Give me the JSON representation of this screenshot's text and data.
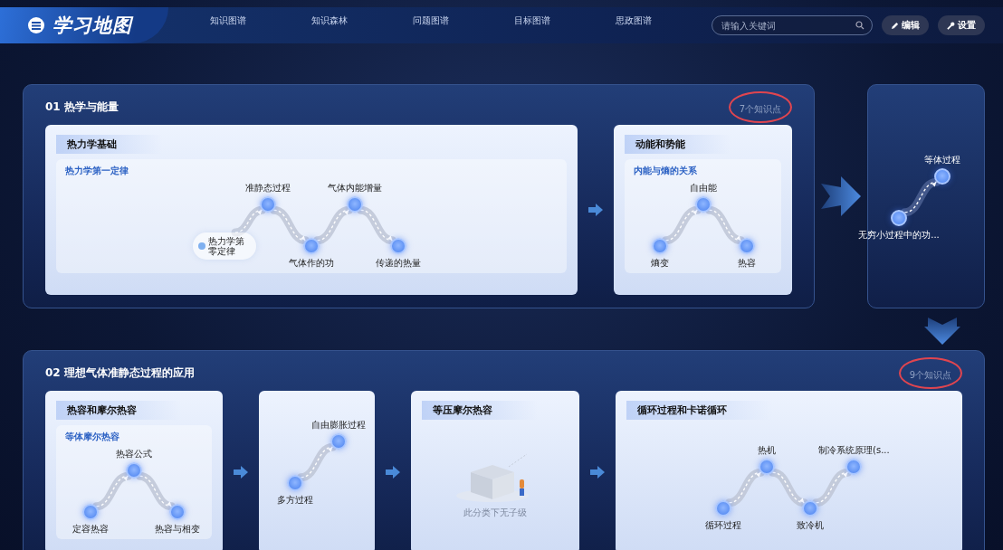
{
  "header": {
    "logo": "学习地图",
    "nav": [
      {
        "label": "知识图谱",
        "selected": false
      },
      {
        "label": "知识森林",
        "selected": false
      },
      {
        "label": "问题图谱",
        "selected": false
      },
      {
        "label": "目标图谱",
        "selected": false
      },
      {
        "label": "思政图谱",
        "selected": false
      }
    ],
    "search": {
      "placeholder": "请输入关键词"
    },
    "buttons": [
      {
        "kind": "edit",
        "label": "编辑"
      },
      {
        "kind": "settings",
        "label": "设置"
      }
    ]
  },
  "sections": [
    {
      "number": "01",
      "title": "热学与能量",
      "count": "7个知识点",
      "count_circled": true,
      "cards": [
        {
          "title": "热力学基础",
          "groups": [
            {
              "title": "热力学第一定律",
              "nodes": [
                {
                  "label": "热力学第零定律",
                  "kind": "start"
                },
                {
                  "label": "准静态过程",
                  "kind": "node"
                },
                {
                  "label": "气体作的功",
                  "kind": "node"
                },
                {
                  "label": "气体内能增量",
                  "kind": "node"
                },
                {
                  "label": "传递的热量",
                  "kind": "node"
                }
              ]
            }
          ]
        },
        {
          "title": "动能和势能",
          "groups": [
            {
              "title": "内能与熵的关系",
              "nodes": [
                {
                  "label": "熵变",
                  "kind": "node"
                },
                {
                  "label": "自由能",
                  "kind": "node"
                },
                {
                  "label": "热容",
                  "kind": "node"
                }
              ]
            }
          ]
        }
      ]
    },
    {
      "number": "02",
      "title": "理想气体准静态过程的应用",
      "count": "9个知识点",
      "count_circled": true,
      "cards": [
        {
          "title": "热容和摩尔热容",
          "groups": [
            {
              "title": "等体摩尔热容",
              "nodes": [
                {
                  "label": "定容热容",
                  "kind": "node"
                },
                {
                  "label": "热容公式",
                  "kind": "node"
                },
                {
                  "label": "热容与相变",
                  "kind": "node"
                }
              ]
            }
          ]
        },
        {
          "nodes": [
            {
              "label": "多方过程",
              "kind": "node"
            },
            {
              "label": "自由膨胀过程",
              "kind": "node"
            }
          ]
        },
        {
          "title": "等压摩尔热容",
          "empty_text": "此分类下无子级"
        },
        {
          "title": "循环过程和卡诺循环",
          "nodes": [
            {
              "label": "循环过程",
              "kind": "node"
            },
            {
              "label": "热机",
              "kind": "node"
            },
            {
              "label": "致冷机",
              "kind": "node"
            },
            {
              "label": "制冷系统原理(s...",
              "kind": "node"
            }
          ]
        }
      ]
    }
  ],
  "continuation": {
    "nodes": [
      {
        "label": "无穷小过程中的功...",
        "kind": "node"
      },
      {
        "label": "等体过程",
        "kind": "node"
      }
    ]
  }
}
